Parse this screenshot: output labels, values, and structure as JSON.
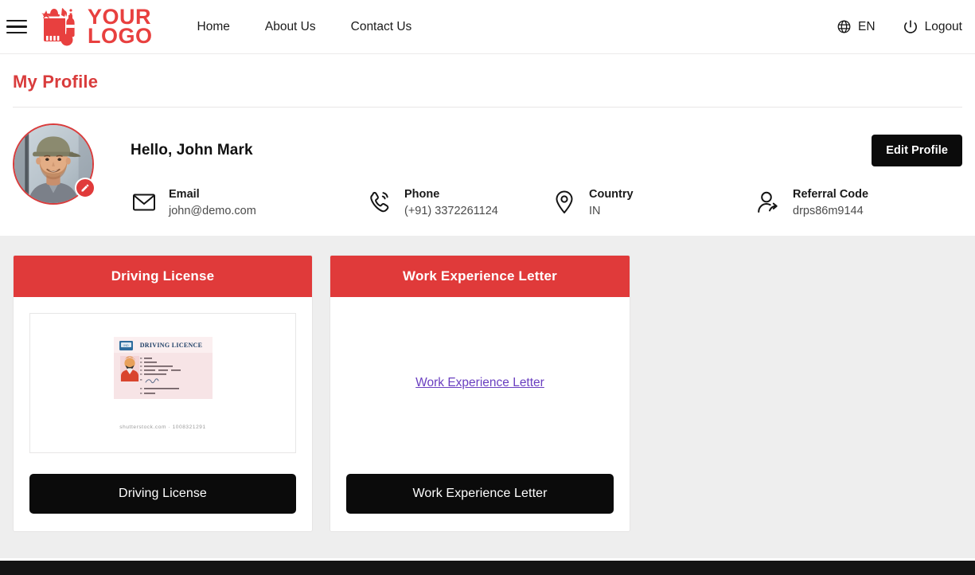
{
  "header": {
    "menu_icon": "hamburger-menu-icon",
    "logo": {
      "line1": "YOUR",
      "line2": "LOGO",
      "icon": "grocery-bag-logo-icon",
      "color": "#e8403f"
    },
    "nav": [
      {
        "label": "Home",
        "name": "nav-home"
      },
      {
        "label": "About Us",
        "name": "nav-about-us"
      },
      {
        "label": "Contact Us",
        "name": "nav-contact-us"
      }
    ],
    "language": {
      "label": "EN",
      "icon": "globe-icon"
    },
    "logout": {
      "label": "Logout",
      "icon": "power-icon"
    }
  },
  "page": {
    "title": "My Profile",
    "title_color": "#d93c3c"
  },
  "profile": {
    "avatar": {
      "name": "user-avatar-photo",
      "edit_badge_icon": "pencil-icon"
    },
    "greeting": "Hello, John Mark",
    "edit_button": "Edit Profile",
    "info": [
      {
        "label": "Email",
        "value": "john@demo.com",
        "icon": "envelope-icon",
        "name": "info-email"
      },
      {
        "label": "Phone",
        "value": "(+91) 3372261124",
        "icon": "phone-ring-icon",
        "name": "info-phone"
      },
      {
        "label": "Country",
        "value": "IN",
        "icon": "map-pin-icon",
        "name": "info-country"
      },
      {
        "label": "Referral Code",
        "value": "drps86m9144",
        "icon": "user-share-icon",
        "name": "info-referral-code"
      }
    ]
  },
  "documents": [
    {
      "header": "Driving License",
      "preview_type": "image",
      "preview_alt": "DRIVING LICENCE",
      "preview_credit": "shutterstock.com · 1008321291",
      "button": "Driving License"
    },
    {
      "header": "Work Experience Letter",
      "preview_type": "link",
      "link_label": "Work Experience Letter",
      "link_color": "#6a3fc0",
      "button": "Work Experience Letter"
    }
  ],
  "theme": {
    "accent_red": "#e03a3a",
    "button_black": "#0b0b0b",
    "page_bg": "#eeeeee",
    "footer_bg": "#141414"
  }
}
